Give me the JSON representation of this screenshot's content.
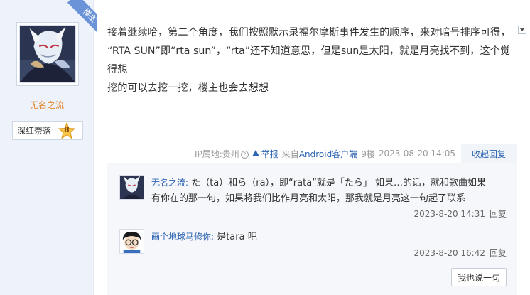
{
  "author": {
    "name": "无名之流",
    "level_name": "深红奈落",
    "level_number": "8",
    "owner_badge": "楼主"
  },
  "post": {
    "content_lines": [
      "接着继续哈，第二个角度，我们按照默示录福尔摩斯事件发生的顺序，来对暗号排序可得，",
      "“RTA SUN”即“rta sun”，“rta”还不知道意思，但是sun是太阳，就是月亮找不到，这个觉得想",
      "挖的可以去挖一挖，楼主也会去想想"
    ]
  },
  "tail": {
    "ip_location": "IP属地:贵州",
    "report": "举报",
    "client": "来自Android客户端",
    "floor": "9楼",
    "time": "2023-08-20 14:05",
    "collapse_reply": "收起回复"
  },
  "replies": [
    {
      "user": "无名之流:",
      "lines": [
        "た（ta）和ら（ra），即“rata”就是「たら」 如果…的话，就和歌曲如果",
        "有你在的那一句，如果将我们比作月亮和太阳，那我就是月亮这一句起了联系"
      ],
      "time": "2023-8-20 14:31",
      "reply_label": "回复"
    },
    {
      "user": "画个地球马修你:",
      "lines": [
        "是tara 吧"
      ],
      "time": "2023-8-20 16:42",
      "reply_label": "回复"
    }
  ],
  "say_button": "我也说一句",
  "colors": {
    "link": "#2d64b3",
    "author_name": "#e0862f",
    "ribbon": "#6a93d8",
    "panel_bg": "#eef3fb"
  },
  "icons": [
    "owner-ribbon",
    "level-star-icon",
    "help-icon",
    "warning-icon",
    "collapse-arrow-icon"
  ]
}
